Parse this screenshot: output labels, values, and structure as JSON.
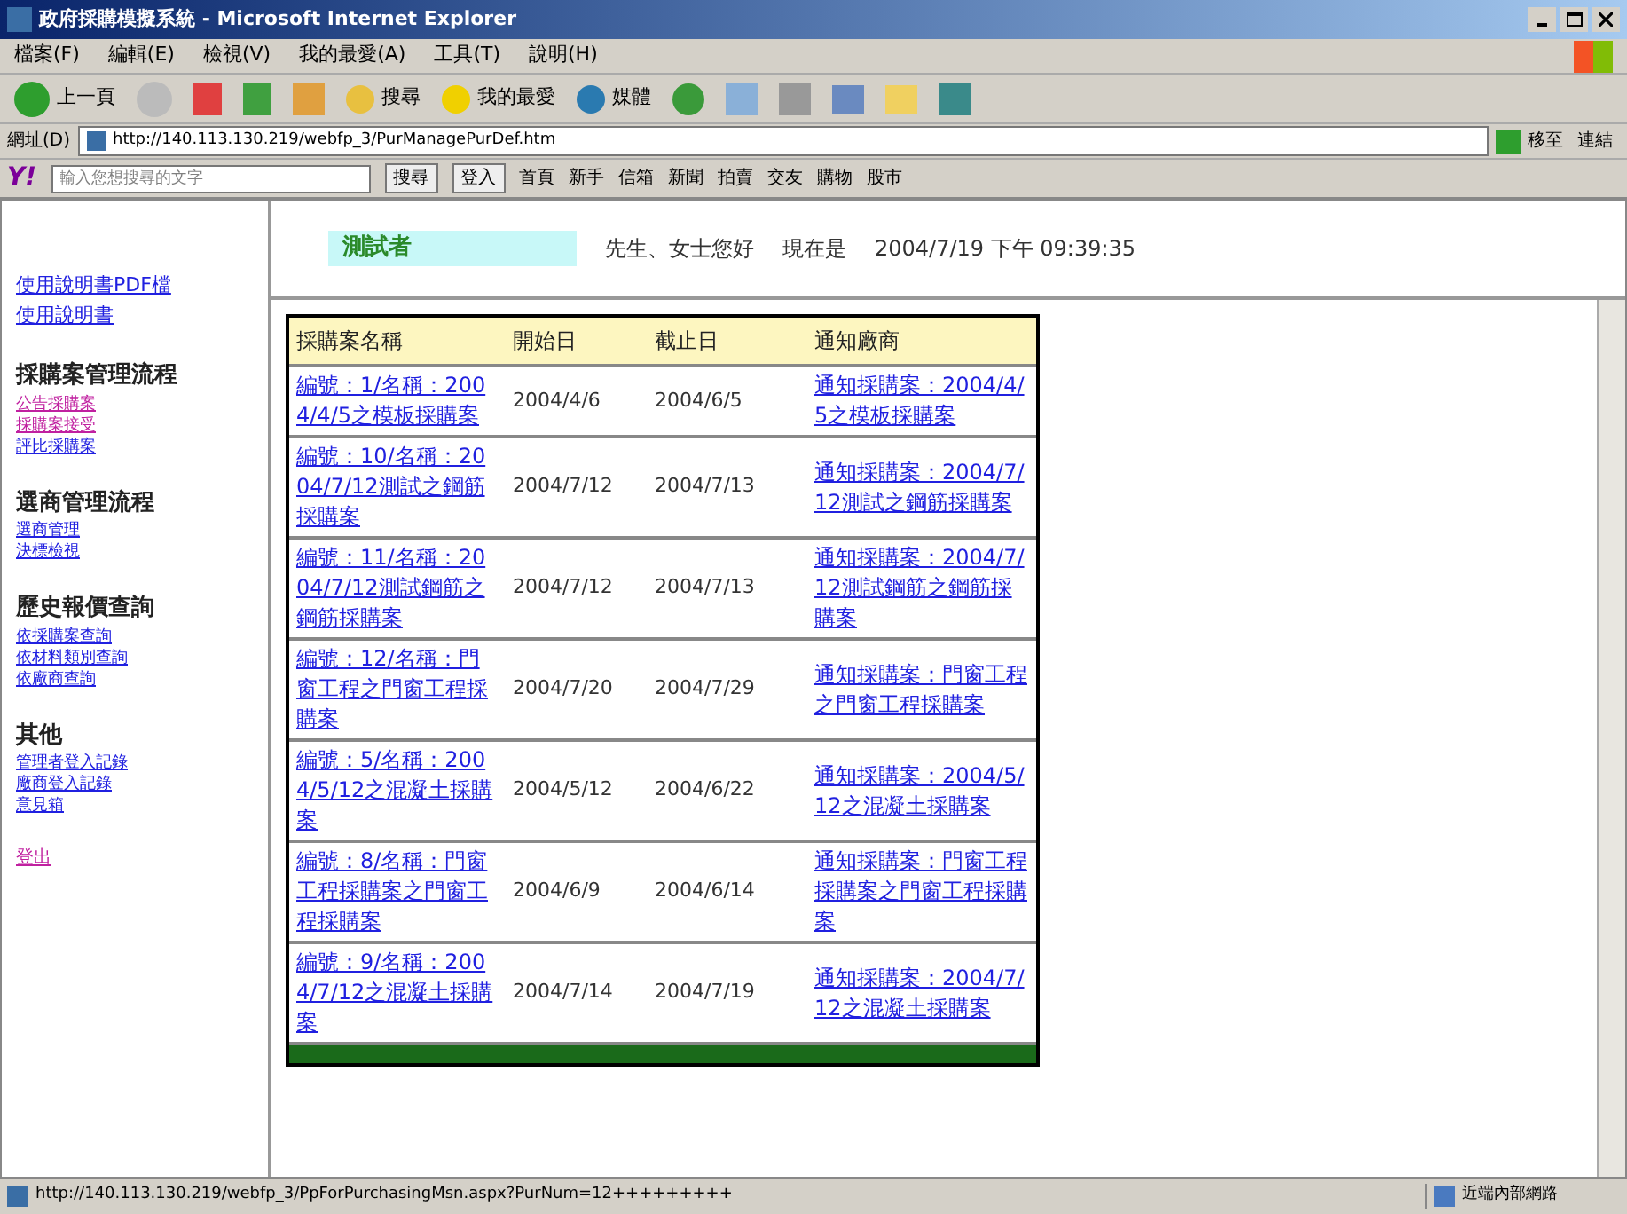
{
  "window": {
    "title": "政府採購模擬系統 - Microsoft Internet Explorer"
  },
  "menu": [
    "檔案(F)",
    "編輯(E)",
    "檢視(V)",
    "我的最愛(A)",
    "工具(T)",
    "說明(H)"
  ],
  "toolbar": {
    "back": "上一頁",
    "search": "搜尋",
    "favorites": "我的最愛",
    "media": "媒體"
  },
  "address_bar": {
    "label": "網址(D)",
    "value": "http://140.113.130.219/webfp_3/PurManagePurDef.htm",
    "go": "移至",
    "links": "連結"
  },
  "yahoo_bar": {
    "logo": "Y!",
    "placeholder": "輸入您想搜尋的文字",
    "search": "搜尋",
    "login": "登入",
    "items": [
      "首頁",
      "新手",
      "信箱",
      "新聞",
      "拍賣",
      "交友",
      "購物",
      "股市"
    ]
  },
  "sidebar": {
    "top_links": [
      {
        "label": "使用說明書PDF檔",
        "visited": false
      },
      {
        "label": "使用說明書",
        "visited": false
      }
    ],
    "sections": [
      {
        "heading": "採購案管理流程",
        "links": [
          {
            "label": "公告採購案",
            "visited": true
          },
          {
            "label": "採購案接受",
            "visited": true
          },
          {
            "label": "評比採購案",
            "visited": false
          }
        ]
      },
      {
        "heading": "選商管理流程",
        "links": [
          {
            "label": "選商管理",
            "visited": false
          },
          {
            "label": "決標檢視",
            "visited": false
          }
        ]
      },
      {
        "heading": "歷史報價查詢",
        "links": [
          {
            "label": "依採購案查詢",
            "visited": false
          },
          {
            "label": "依材料類別查詢",
            "visited": false
          },
          {
            "label": "依廠商查詢",
            "visited": false
          }
        ]
      },
      {
        "heading": "其他",
        "links": [
          {
            "label": "管理者登入記錄",
            "visited": false
          },
          {
            "label": "廠商登入記錄",
            "visited": false
          },
          {
            "label": "意見箱",
            "visited": false
          }
        ]
      }
    ],
    "logout": {
      "label": "登出",
      "visited": true
    }
  },
  "header": {
    "user": "測試者",
    "greeting": "先生、女士您好",
    "now_label": "現在是",
    "datetime": "2004/7/19 下午 09:39:35"
  },
  "table": {
    "columns": [
      "採購案名稱",
      "開始日",
      "截止日",
      "通知廠商"
    ],
    "rows": [
      {
        "name": "編號：1/名稱：2004/4/5之模板採購案",
        "start": "2004/4/6",
        "end": "2004/6/5",
        "notify": "通知採購案：2004/4/5之模板採購案"
      },
      {
        "name": "編號：10/名稱：2004/7/12測試之鋼筋採購案",
        "start": "2004/7/12",
        "end": "2004/7/13",
        "notify": "通知採購案：2004/7/12測試之鋼筋採購案"
      },
      {
        "name": "編號：11/名稱：2004/7/12測試鋼筋之鋼筋採購案",
        "start": "2004/7/12",
        "end": "2004/7/13",
        "notify": "通知採購案：2004/7/12測試鋼筋之鋼筋採購案"
      },
      {
        "name": "編號：12/名稱：門窗工程之門窗工程採購案",
        "start": "2004/7/20",
        "end": "2004/7/29",
        "notify": "通知採購案：門窗工程之門窗工程採購案"
      },
      {
        "name": "編號：5/名稱：2004/5/12之混凝土採購案",
        "start": "2004/5/12",
        "end": "2004/6/22",
        "notify": "通知採購案：2004/5/12之混凝土採購案"
      },
      {
        "name": "編號：8/名稱：門窗工程採購案之門窗工程採購案",
        "start": "2004/6/9",
        "end": "2004/6/14",
        "notify": "通知採購案：門窗工程採購案之門窗工程採購案"
      },
      {
        "name": "編號：9/名稱：2004/7/12之混凝土採購案",
        "start": "2004/7/14",
        "end": "2004/7/19",
        "notify": "通知採購案：2004/7/12之混凝土採購案"
      }
    ]
  },
  "status_bar": {
    "url": "http://140.113.130.219/webfp_3/PpForPurchasingMsn.aspx?PurNum=12+++++++++",
    "zone": "近端內部網路"
  }
}
